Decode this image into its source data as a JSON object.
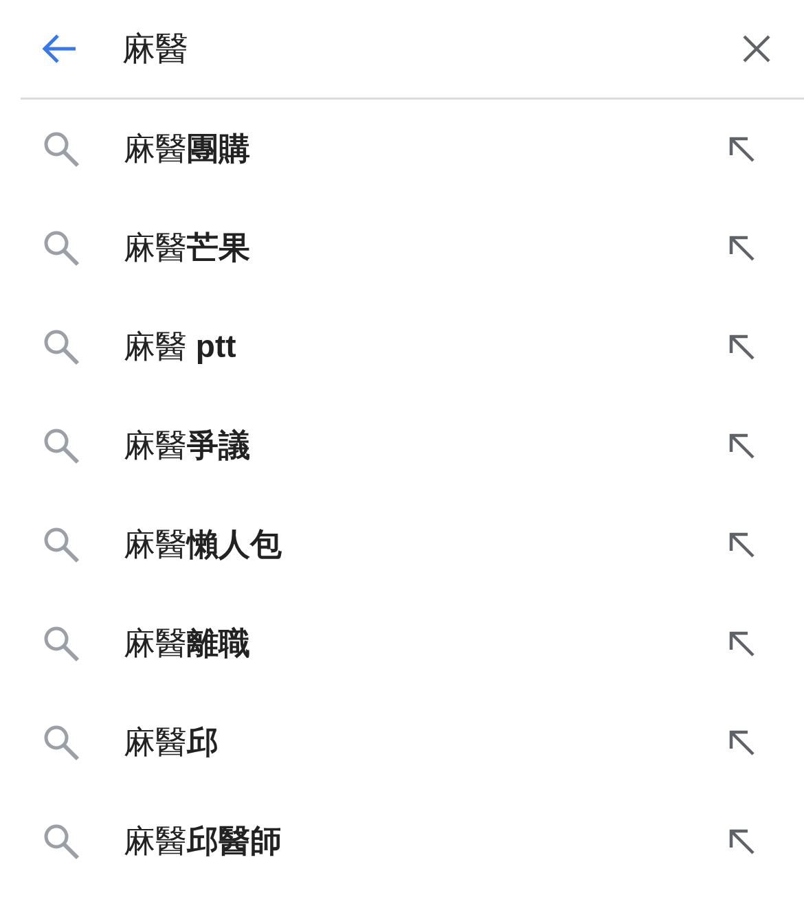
{
  "search_bar": {
    "query": "麻醫"
  },
  "suggestions": [
    {
      "text": "麻醫**團購**"
    },
    {
      "text": "麻醫**芒果**"
    },
    {
      "text": "麻醫 **ptt**"
    },
    {
      "text": "麻醫**爭議**"
    },
    {
      "text": "麻醫**懶人包**"
    },
    {
      "text": "麻醫**離職**"
    },
    {
      "text": "麻醫**邱**"
    },
    {
      "text": "麻醫**邱醫師**"
    }
  ]
}
